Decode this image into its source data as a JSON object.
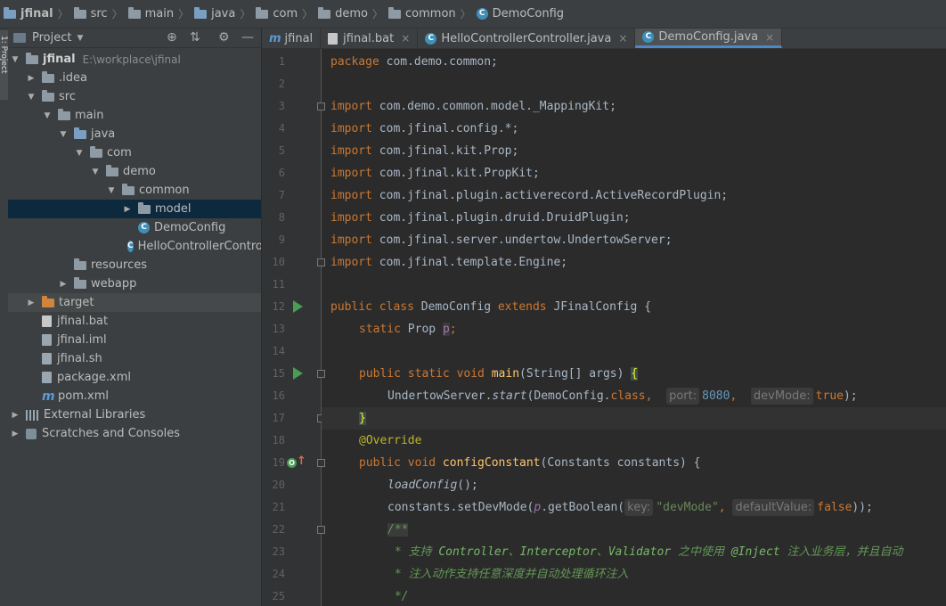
{
  "breadcrumbs": [
    "jfinal",
    "src",
    "main",
    "java",
    "com",
    "demo",
    "common",
    "DemoConfig"
  ],
  "left_strip_label": "1: Project",
  "project_panel": {
    "title": "Project",
    "tree": [
      {
        "label": "jfinal",
        "hint": "E:\\workplace\\jfinal",
        "depth": 0,
        "toggle": "▼",
        "icon": "folder-icon",
        "bold": true
      },
      {
        "label": ".idea",
        "depth": 1,
        "toggle": "▶",
        "icon": "folder-icon"
      },
      {
        "label": "src",
        "depth": 1,
        "toggle": "▼",
        "icon": "folder-icon"
      },
      {
        "label": "main",
        "depth": 2,
        "toggle": "▼",
        "icon": "folder-icon"
      },
      {
        "label": "java",
        "depth": 3,
        "toggle": "▼",
        "icon": "source-folder-icon"
      },
      {
        "label": "com",
        "depth": 4,
        "toggle": "▼",
        "icon": "package-icon"
      },
      {
        "label": "demo",
        "depth": 5,
        "toggle": "▼",
        "icon": "package-icon"
      },
      {
        "label": "common",
        "depth": 6,
        "toggle": "▼",
        "icon": "package-icon"
      },
      {
        "label": "model",
        "depth": 7,
        "toggle": "▶",
        "icon": "package-icon",
        "selected": true
      },
      {
        "label": "DemoConfig",
        "depth": 7,
        "toggle": "",
        "icon": "java-class-icon"
      },
      {
        "label": "HelloControllerController",
        "depth": 7,
        "toggle": "",
        "icon": "java-class-icon"
      },
      {
        "label": "resources",
        "depth": 3,
        "toggle": "",
        "icon": "resources-folder-icon"
      },
      {
        "label": "webapp",
        "depth": 3,
        "toggle": "▶",
        "icon": "folder-icon"
      },
      {
        "label": "target",
        "depth": 1,
        "toggle": "▶",
        "icon": "excluded-folder-icon",
        "shaded": true
      },
      {
        "label": "jfinal.bat",
        "depth": 1,
        "toggle": "",
        "icon": "bat-file-icon"
      },
      {
        "label": "jfinal.iml",
        "depth": 1,
        "toggle": "",
        "icon": "iml-file-icon"
      },
      {
        "label": "jfinal.sh",
        "depth": 1,
        "toggle": "",
        "icon": "sh-file-icon"
      },
      {
        "label": "package.xml",
        "depth": 1,
        "toggle": "",
        "icon": "xml-file-icon"
      },
      {
        "label": "pom.xml",
        "depth": 1,
        "toggle": "",
        "icon": "maven-icon"
      },
      {
        "label": "External Libraries",
        "depth": 0,
        "toggle": "▶",
        "icon": "libraries-icon"
      },
      {
        "label": "Scratches and Consoles",
        "depth": 0,
        "toggle": "▶",
        "icon": "scratches-icon"
      }
    ]
  },
  "editor_tabs": [
    {
      "label": "jfinal",
      "icon": "maven-icon",
      "closable": false
    },
    {
      "label": "jfinal.bat",
      "icon": "bat-file-icon",
      "closable": true,
      "close": "×"
    },
    {
      "label": "HelloControllerController.java",
      "icon": "java-class-icon",
      "closable": true,
      "close": "×"
    },
    {
      "label": "DemoConfig.java",
      "icon": "java-class-icon",
      "closable": true,
      "close": "×",
      "active": true
    }
  ],
  "line_numbers": [
    "1",
    "2",
    "3",
    "4",
    "5",
    "6",
    "7",
    "8",
    "9",
    "10",
    "11",
    "12",
    "13",
    "14",
    "15",
    "16",
    "17",
    "18",
    "19",
    "20",
    "21",
    "22",
    "23",
    "24",
    "25"
  ],
  "code": {
    "l1": {
      "kw": "package",
      "rest": " com.demo.common;"
    },
    "imports": [
      {
        "kw": "import",
        "rest": " com.demo.common.model._MappingKit;"
      },
      {
        "kw": "import",
        "rest": " com.jfinal.config.*;"
      },
      {
        "kw": "import",
        "rest": " com.jfinal.kit.Prop;"
      },
      {
        "kw": "import",
        "rest": " com.jfinal.kit.PropKit;"
      },
      {
        "kw": "import",
        "rest": " com.jfinal.plugin.activerecord.ActiveRecordPlugin;"
      },
      {
        "kw": "import",
        "rest": " com.jfinal.plugin.druid.DruidPlugin;"
      },
      {
        "kw": "import",
        "rest": " com.jfinal.server.undertow.UndertowServer;"
      },
      {
        "kw": "import",
        "rest": " com.jfinal.template.Engine;"
      }
    ],
    "l12": {
      "kw1": "public class",
      "cls": " DemoConfig ",
      "kw2": "extends",
      "rest": " JFinalConfig {"
    },
    "l13": {
      "kw": "static",
      "type": " Prop ",
      "fld": "p",
      "end": ";"
    },
    "l15": {
      "kw": "public static void",
      "fn": "main",
      "args": "(String[] args) ",
      "brace": "{"
    },
    "l16": {
      "a": "UndertowServer.",
      "b": "start",
      "c": "(DemoConfig.",
      "d": "class",
      "e": ", ",
      "h1": "port:",
      "n1": "8080",
      "f": ", ",
      "h2": "devMode:",
      "k": "true",
      "g": ");"
    },
    "l17": {
      "brace": "}"
    },
    "l18": {
      "ann": "@Override"
    },
    "l19": {
      "kw": "public void",
      "fn": "configConstant",
      "rest": "(Constants constants) {"
    },
    "l20": {
      "it": "loadConfig",
      "rest": "();"
    },
    "l21": {
      "a": "constants.setDevMode(",
      "fld": "p",
      "b": ".getBoolean(",
      "h1": "key:",
      "s": "\"devMode\"",
      "c": ", ",
      "h2": "defaultValue:",
      "k": "false",
      "d": "));"
    },
    "l22": {
      "cm": "/**"
    },
    "l23": {
      "a": " * 支持 ",
      "t1": "Controller",
      "b": "、",
      "t2": "Interceptor",
      "c": "、",
      "t3": "Validator",
      "d": " 之中使用 ",
      "t4": "@Inject",
      "e": " 注入业务层，并且自动"
    },
    "l24": {
      "cm": " * 注入动作支持任意深度并自动处理循环注入"
    },
    "l25": {
      "cm": " */"
    }
  },
  "colors": {
    "keyword": "#cc7832",
    "string": "#6a8759",
    "number": "#6897bb",
    "field": "#9876aa",
    "method": "#ffc66d",
    "comment": "#629755",
    "annotation": "#bbb529",
    "selection": "#0d293e"
  }
}
